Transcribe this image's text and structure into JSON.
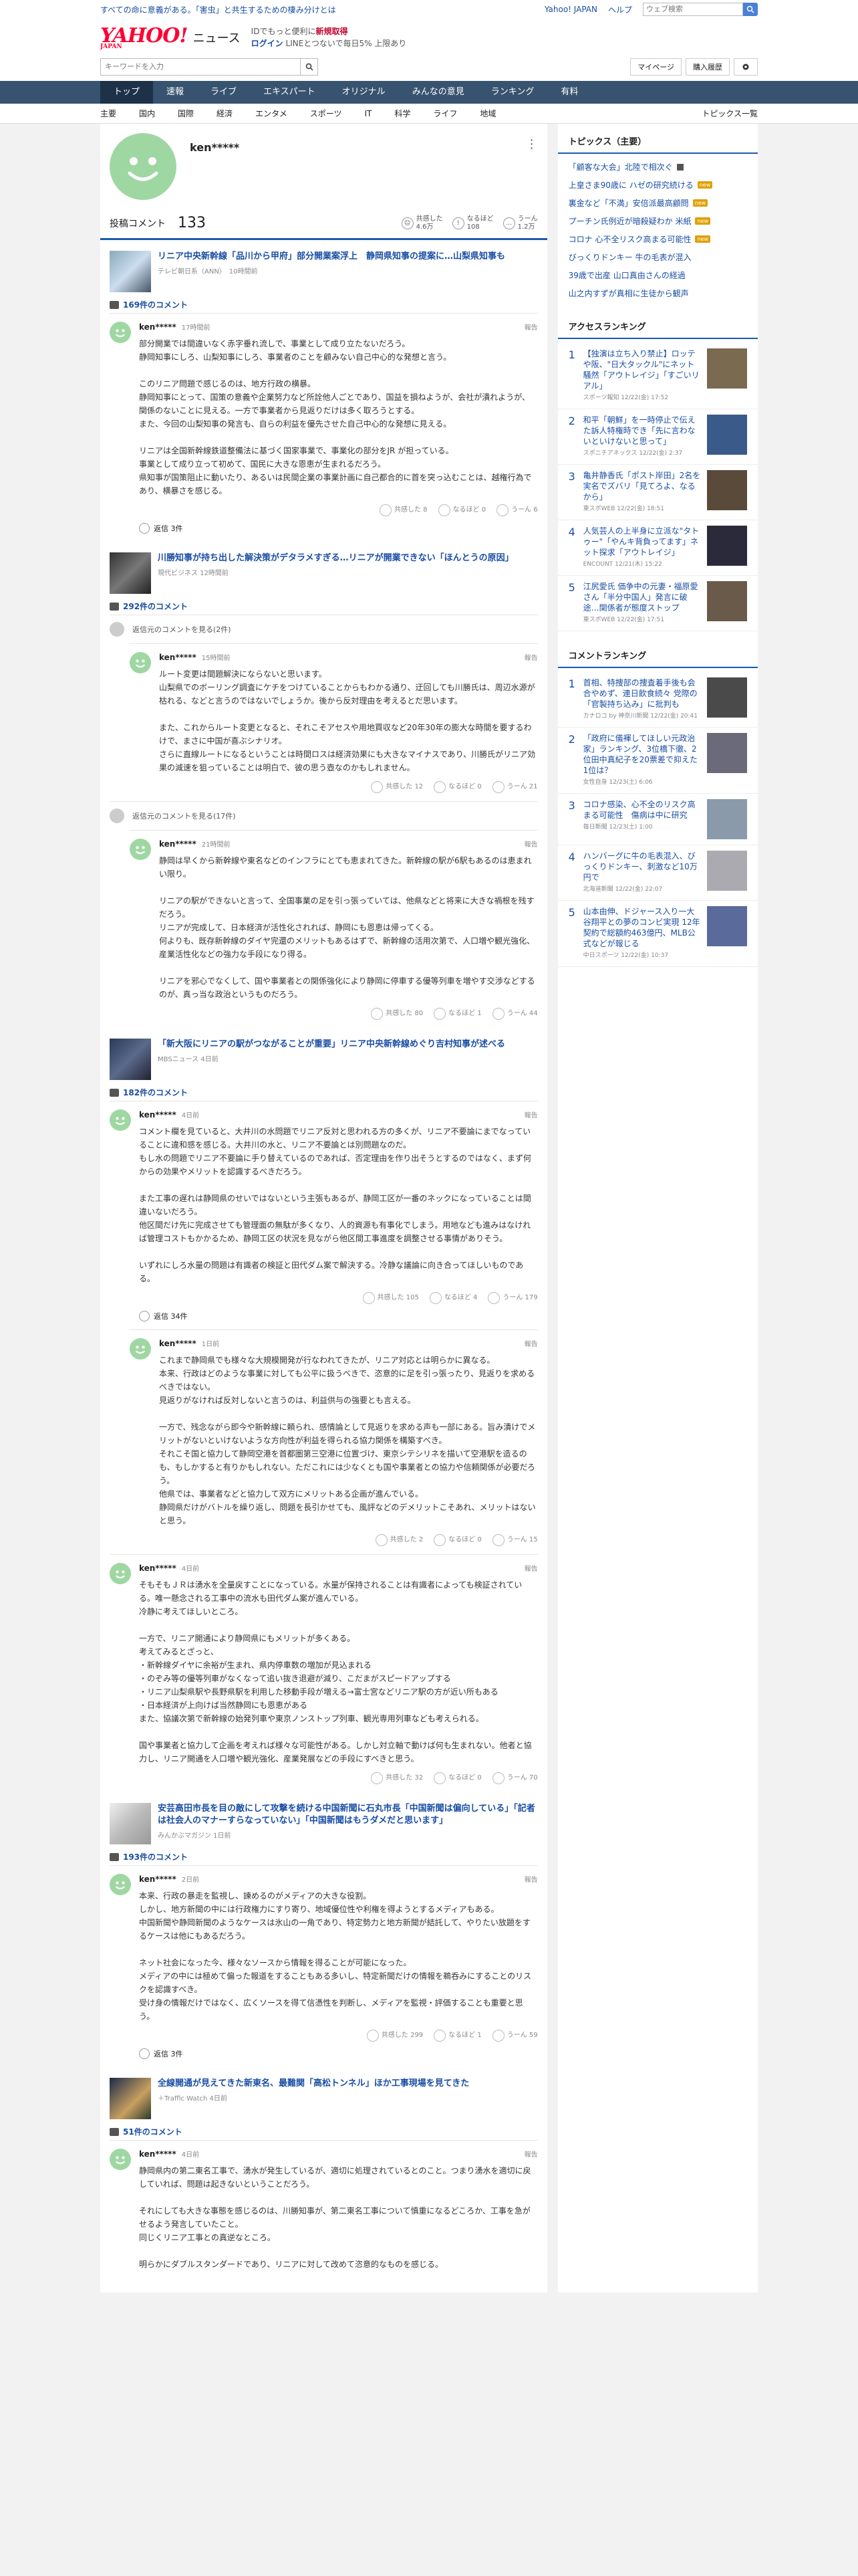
{
  "top": {
    "tagline": "すべての命に意義がある。「害虫」と共生するための棲み分けとは",
    "links": [
      "Yahoo! JAPAN",
      "ヘルプ"
    ],
    "search_placeholder": "ウェブ検索"
  },
  "header": {
    "logo": "YAHOO!",
    "logo_small": "JAPAN",
    "section": "ニュース",
    "line1_a": "IDでもっと便利に",
    "line1_b": "新規取得",
    "login": "ログイン",
    "line2": "LINEとつないで毎日5% 上限あり"
  },
  "search": {
    "placeholder": "キーワードを入力",
    "mypage": "マイページ",
    "purchase": "購入履歴"
  },
  "nav": [
    "トップ",
    "速報",
    "ライブ",
    "エキスパート",
    "オリジナル",
    "みんなの意見",
    "ランキング",
    "有料"
  ],
  "subnav": [
    "主要",
    "国内",
    "国際",
    "経済",
    "エンタメ",
    "スポーツ",
    "IT",
    "科学",
    "ライフ",
    "地域"
  ],
  "subnav_last": "トピックス一覧",
  "profile": {
    "name": "ken*****",
    "posted_label": "投稿コメント",
    "posted_count": "133",
    "stats": [
      {
        "label": "共感した",
        "value": "4.6万"
      },
      {
        "label": "なるほど",
        "value": "108"
      },
      {
        "label": "うーん",
        "value": "1.2万"
      }
    ]
  },
  "articles": [
    {
      "title": "リニア中央新幹線「品川から甲府」部分開業案浮上　静岡県知事の提案に…山梨県知事も",
      "source": "テレビ朝日系（ANN）　10時間前",
      "count": "169件のコメント"
    },
    {
      "title": "川勝知事が持ち出した解決策がデタラメすぎる…リニアが開業できない「ほんとうの原因」",
      "source": "現代ビジネス 12時間前",
      "count": "292件のコメント"
    },
    {
      "title": "「新大阪にリニアの駅がつながることが重要」リニア中央新幹線めぐり吉村知事が述べる",
      "source": "MBSニュース 4日前",
      "count": "182件のコメント"
    },
    {
      "title": "安芸高田市長を目の敵にして攻撃を続ける中国新聞に石丸市長「中国新聞は偏向している」「記者は社会人のマナーすらなっていない」「中国新聞はもうダメだと思います」",
      "source": "みんかぶマガジン 1日前",
      "count": "193件のコメント"
    },
    {
      "title": "全線開通が見えてきた新東名、最難関「高松トンネル」ほか工事現場を見てきた",
      "source": "＋Traffic Watch 4日前",
      "count": "51件のコメント"
    }
  ],
  "comments": {
    "c1": {
      "user": "ken*****",
      "time": "17時間前",
      "report": "報告",
      "text": "部分開業では間違いなく赤字垂れ流しで、事業として成り立たないだろう。\n静岡知事にしろ、山梨知事にしろ、事業者のことを顧みない自己中心的な発想と言う。\n\nこのリニア問題で感じるのは、地方行政の横暴。\n静岡知事にとって、国策の意義や企業努力など所詮他人ごとであり、国益を損ねようが、会社が潰れようが、関係のないことに見える。一方で事業者から見返りだけは多く取ろうとする。\nまた、今回の山梨知事の発言も、自らの利益を優先させた自己中心的な発想に見える。\n\nリニアは全国新幹線鉄道整備法に基づく国家事業で、事業化の部分をJR が担っている。\n事業として成り立って初めて、国民に大きな恩恵が生まれるだろう。\n県知事が国策阻止に動いたり、あるいは民間企業の事業計画に自己都合的に首を突っ込むことは、越権行為であり、横暴さを感じる。",
      "reacts": [
        "共感した 8",
        "なるほど 0",
        "うーん 6"
      ],
      "replies": "返信 3件"
    },
    "c2": {
      "user": "ken*****",
      "time": "15時間前",
      "report": "報告",
      "text": "ルート変更は間題解決にならないと思います。\n山梨県でのボーリング調査にケチをつけていることからもわかる通り、迂回しても川勝氏は、周辺水源が枯れる、などと言うのではないでしょうか。後から反対理由を考えるとだ思います。\n\nまた、これからルート変更となると、それこそアセスや用地買収など20年30年の膨大な時間を要するわけで、まさに中国が喜ぶシナリオ。\nさらに直線ルートになるということは時間ロスは経済効果にも大きなマイナスであり、川勝氏がリニア効果の減速を狙っていることは明白で、彼の思う壺なのかもしれません。",
      "reacts": [
        "共感した 12",
        "なるほど 0",
        "うーん 21"
      ]
    },
    "c3": {
      "user": "ken*****",
      "time": "21時間前",
      "report": "報告",
      "text": "静岡は早くから新幹線や東名などのインフラにとても恵まれてきた。新幹線の駅が6駅もあるのは恵まれい限り。\n\nリニアの駅ができないと言って、全国事業の足を引っ張っていては、他県などと将来に大きな禍根を残すだろう。\nリニアが完成して、日本経済が活性化されれば、静岡にも恩恵は帰ってくる。\n何よりも、既存新幹線のダイヤ完還のメリットもあるはずで、新幹線の活用次第で、人口増や観光強化、産業活性化などの強力な手段になり得る。\n\nリニアを邪心でなくして、国や事業者との関係強化により静岡に停車する優等列車を増やす交渉などするのが、真っ当な政治というものだろう。",
      "reacts": [
        "共感した 80",
        "なるほど 1",
        "うーん 44"
      ]
    },
    "c4": {
      "user": "ken*****",
      "time": "4日前",
      "report": "報告",
      "text": "コメント欄を見ていると、大井川の水問題でリニア反対と思われる方の多くが、リニア不要論にまでなっていることに違和感を感じる。大井川の水と、リニア不要論とは別問題なのだ。\nもし水の問題でリニア不要論に手り替えているのであれば、否定理由を作り出そうとするのではなく、まず何からの効果やメリットを認識するべきだろう。\n\nまた工事の遅れは静岡県のせいではないという主張もあるが、静岡工区が一番のネックになっていることは間違いないだろう。\n他区間だけ先に完成させても管理面の無駄が多くなり、人的資源も有事化でしまう。用地なども進みはなければ管理コストもかかるため、静岡工区の状況を見ながら他区間工事進度を調整させる事情がありそう。\n\nいずれにしろ水量の問題は有識者の検証と田代ダム案で解決する。冷静な議論に向き合ってほしいものである。",
      "reacts": [
        "共感した 105",
        "なるほど 4",
        "うーん 179"
      ],
      "replies": "返信 34件"
    },
    "c5": {
      "user": "ken*****",
      "time": "1日前",
      "report": "報告",
      "text": "これまで静岡県でも様々な大規模開発が行なわれてきたが、リニア対応とは明らかに異なる。\n本来、行政はどのような事業に対しても公平に扱うべきで、恣意的に足を引っ張ったり、見返りを求めるべきではない。\n見返りがなければ反対しないと言うのは、利益供与の強要とも言える。\n\n一方で、残念ながら即今や新幹線に頼られ、感情論として見返りを求める声も一部にある。旨み漬けでメリットがないといけないような方向性が利益を得られる協力関係を構築すべき。\nそれこそ国と協力して静岡空港を首都圏第三空港に位置づけ、東京シテシリネを描いて空港駅を造るのも、もしかすると有りかもしれない。ただこれには少なくとも国や事業者との協力や信頼関係が必要だろう。\n他県では、事業者などと協力して双方にメリットある企画が進んでいる。\n静岡県だけがバトルを繰り返し、問題を長引かせても、風評などのデメリットこそあれ、メリットはないと思う。",
      "reacts": [
        "共感した 2",
        "なるほど 0",
        "うーん 15"
      ]
    },
    "c6": {
      "user": "ken*****",
      "time": "4日前",
      "report": "報告",
      "text": "そもそもＪＲは湧水を全量戻すことになっている。水量が保持されることは有識者によっても検証されている。唯一懸念される工事中の流水も田代ダム案が進んでいる。\n冷静に考えてほしいところ。\n\n一方で、リニア開通により静岡県にもメリットが多くある。\n考えてみるとざっと、\n・新幹線ダイヤに余裕が生まれ、県内停車数の増加が見込まれる\n・のぞみ等の優等列車がなくなって追い抜き退避が減り、こだまがスピードアップする\n・リニア山梨県駅や長野県駅を利用した移動手段が増える→富士宮などリニア駅の方が近い所もある\n・日本経済が上向けば当然静岡にも恩恵がある\nまた、協議次第で新幹線の始発列車や東京ノンストップ列車、観光専用列車なども考えられる。\n\n国や事業者と協力して企画を考えれば様々な可能性がある。しかし対立軸で動けば何も生まれない。他者と協力し、リニア開通を人口増や観光強化、産業発展などの手段にすべきと思う。",
      "reacts": [
        "共感した 32",
        "なるほど 0",
        "うーん 70"
      ]
    },
    "c7": {
      "user": "ken*****",
      "time": "2日前",
      "report": "報告",
      "text": "本来、行政の暴走を監視し、諫めるのがメディアの大きな役割。\nしかし、地方新聞の中には行政権力にすり寄り、地域優位性や利権を得ようとするメディアもある。\n中国新聞や静岡新聞のようなケースは氷山の一角であり、特定勢力と地方新聞が結託して、やりたい放題をするケースは他にもあるだろう。\n\nネット社会になった今、様々なソースから情報を得ることが可能になった。\nメディアの中には極めて偏った報道をすることもある多いし、特定新聞だけの情報を鵜呑みにすることのリスクを認識すべき。\n受け身の情報だけではなく、広くソースを得て信憑性を判断し、メディアを監視・評価することも重要と思う。",
      "reacts": [
        "共感した 299",
        "なるほど 1",
        "うーん 59"
      ],
      "replies": "返信 3件"
    },
    "c8": {
      "user": "ken*****",
      "time": "4日前",
      "report": "報告",
      "text": "静岡県内の第二東名工事で、湧水が発生しているが、適切に処理されているとのこと。つまり湧水を適切に戻していれば、問題は起きないということだろう。\n\nそれにしても大きな事態を感じるのは、川勝知事が、第二東名工事について慎重になるどころか、工事を急がせるよう発言していたこと。\n同じくリニア工事との真逆なところ。\n\n明らかにダブルスタンダードであり、リニアに対して改めて恣意的なものを感じる。"
    }
  },
  "collapsed": {
    "a": "返信元のコメントを見る(2件)",
    "b": "返信元のコメントを見る(17件)"
  },
  "side": {
    "topics_head": "トピックス（主要）",
    "topics": [
      "「顧客な大会」北陸で相次ぐ",
      "上皇さま90歳に ハゼの研究続ける",
      "裏金など「不満」安倍派最高顧問",
      "プーチン氏例近が暗殺疑わか 米紙",
      "コロナ 心不全リスク高まる可能性",
      "びっくりドンキー 牛の毛表が混入",
      "39歳で出産 山口真由さんの経過",
      "山之内すずが真相に生徒から観声"
    ],
    "access_head": "アクセスランキング",
    "access": [
      {
        "n": "1",
        "t": "【独演は立ち入り禁止】ロッテや阪、\"日大タックル\"にネット騒然「アウトレイジ」「すごいリアル」",
        "s": "スポーツ報知 12/22(金) 17:52"
      },
      {
        "n": "2",
        "t": "和平「朝鮮」を一時停止で伝えた訴人特権時でき「先に言わないといけないと思って」",
        "s": "スポニチアネックス 12/22(金) 2:37"
      },
      {
        "n": "3",
        "t": "亀井静香氏「ポスト岸田」2名を実名でズバリ「見てろよ、なるから」",
        "s": "東スポWEB 12/22(金) 18:51"
      },
      {
        "n": "4",
        "t": "人気芸人の上半身に立派な\"タトゥー\"「やんキ背負ってます」ネット探求「アウトレイジ」",
        "s": "ENCOUNT 12/21(木) 15:22"
      },
      {
        "n": "5",
        "t": "江尻愛氏 価争中の元妻・福原愛さん「半分中国人」発言に破途…関係者が態度ストップ",
        "s": "東スポWEB 12/22(金) 17:51"
      }
    ],
    "comment_head": "コメントランキング",
    "crank": [
      {
        "n": "1",
        "t": "首相、特捜部の捜査着手後も会合やめず、連日飲食続々 党際の「官製持ち込み」に批判も",
        "s": "カナロコ by 神奈川新聞 12/22(金) 20:41"
      },
      {
        "n": "2",
        "t": "「政府に儀褌してほしい元政治家」ランキング、3位橋下徹、2位田中真紀子を20票差で抑えた1位は？",
        "s": "女性自身 12/23(土) 6:06"
      },
      {
        "n": "3",
        "t": "コロナ感染、心不全のリスク高まる可能性　傷病は中に研究",
        "s": "毎日新聞 12/23(土) 1:00"
      },
      {
        "n": "4",
        "t": "ハンバーグに牛の毛表混入、びっくりドンキー、刺激など10万円で",
        "s": "北海道新聞 12/22(金) 22:07"
      },
      {
        "n": "5",
        "t": "山本由伸、ドジャース入り一大谷翔平との夢のコンビ実現 12年契約で総額約463億円、MLB公式などが報じる",
        "s": "中日スポーツ 12/22(金) 10:37"
      }
    ]
  }
}
